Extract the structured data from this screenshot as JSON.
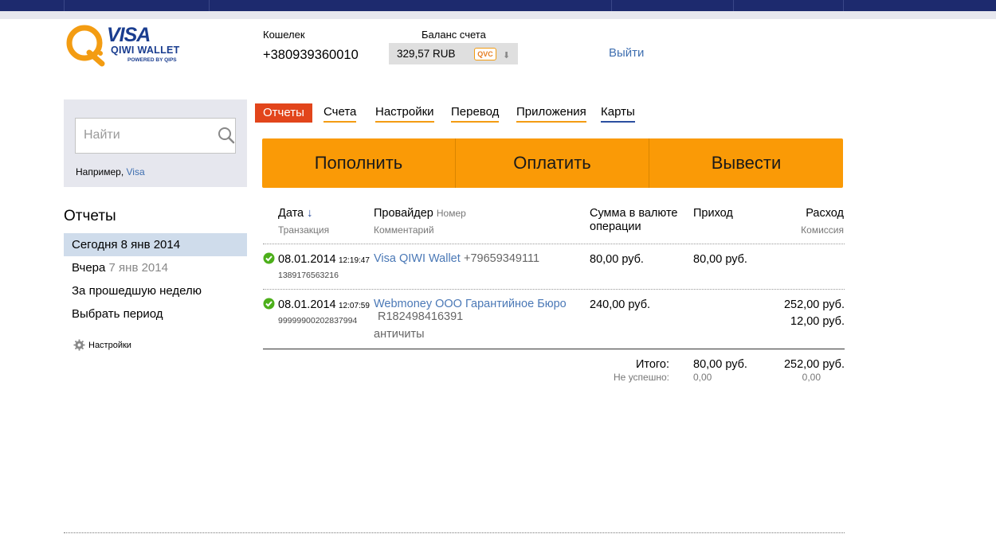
{
  "header": {
    "brand": {
      "visa": "VISA",
      "qiwi_wallet": "QIWI WALLET",
      "powered_by": "POWERED BY QIPS"
    },
    "wallet_label": "Кошелек",
    "wallet_number": "+380939360010",
    "balance_label": "Баланс счета",
    "balance_value": "329,57 RUB",
    "currency_badge": "QVC",
    "logout": "Выйти"
  },
  "search": {
    "placeholder": "Найти",
    "example_prefix": "Например, ",
    "example_link": "Visa"
  },
  "sidebar": {
    "title": "Отчеты",
    "periods": [
      {
        "label": "Сегодня 8 янв 2014",
        "active": true
      },
      {
        "label": "Вчера",
        "date": "7 янв 2014"
      },
      {
        "label": "За прошедшую неделю"
      },
      {
        "label": "Выбрать период"
      }
    ],
    "settings": "Настройки"
  },
  "tabs": [
    "Отчеты",
    "Счета",
    "Настройки",
    "Перевод",
    "Приложения",
    "Карты"
  ],
  "actions": [
    "Пополнить",
    "Оплатить",
    "Вывести"
  ],
  "table": {
    "headers": {
      "date": "Дата",
      "date_sort_arrow": "↓",
      "transaction": "Транзакция",
      "provider": "Провайдер",
      "number": "Номер",
      "comment": "Комментарий",
      "amount_line1": "Сумма в валюте",
      "amount_line2": "операции",
      "income": "Приход",
      "expense": "Расход",
      "commission": "Комиссия"
    },
    "rows": [
      {
        "date": "08.01.2014",
        "time": "12:19:47",
        "transaction_id": "1389176563216",
        "provider": "Visa QIWI Wallet",
        "number": "+79659349111",
        "comment": "",
        "amount": "80,00 руб.",
        "income": "80,00 руб.",
        "expense": "",
        "commission": ""
      },
      {
        "date": "08.01.2014",
        "time": "12:07:59",
        "transaction_id": "99999900202837994",
        "provider": "Webmoney ООО Гарантийное Бюро",
        "number": "R182498416391",
        "comment": "античиты",
        "amount": "240,00 руб.",
        "income": "",
        "expense": "252,00 руб.",
        "commission": "12,00 руб."
      }
    ],
    "totals": {
      "label": "Итого:",
      "failed_label": "Не успешно:",
      "income": "80,00 руб.",
      "income_failed": "0,00",
      "expense": "252,00 руб.",
      "expense_failed": "0,00"
    }
  },
  "colors": {
    "topbar": "#1d2a6e",
    "accent_orange": "#fa9a06",
    "active_tab": "#e2451b",
    "link": "#4a78b6",
    "success": "#4caf1a"
  }
}
